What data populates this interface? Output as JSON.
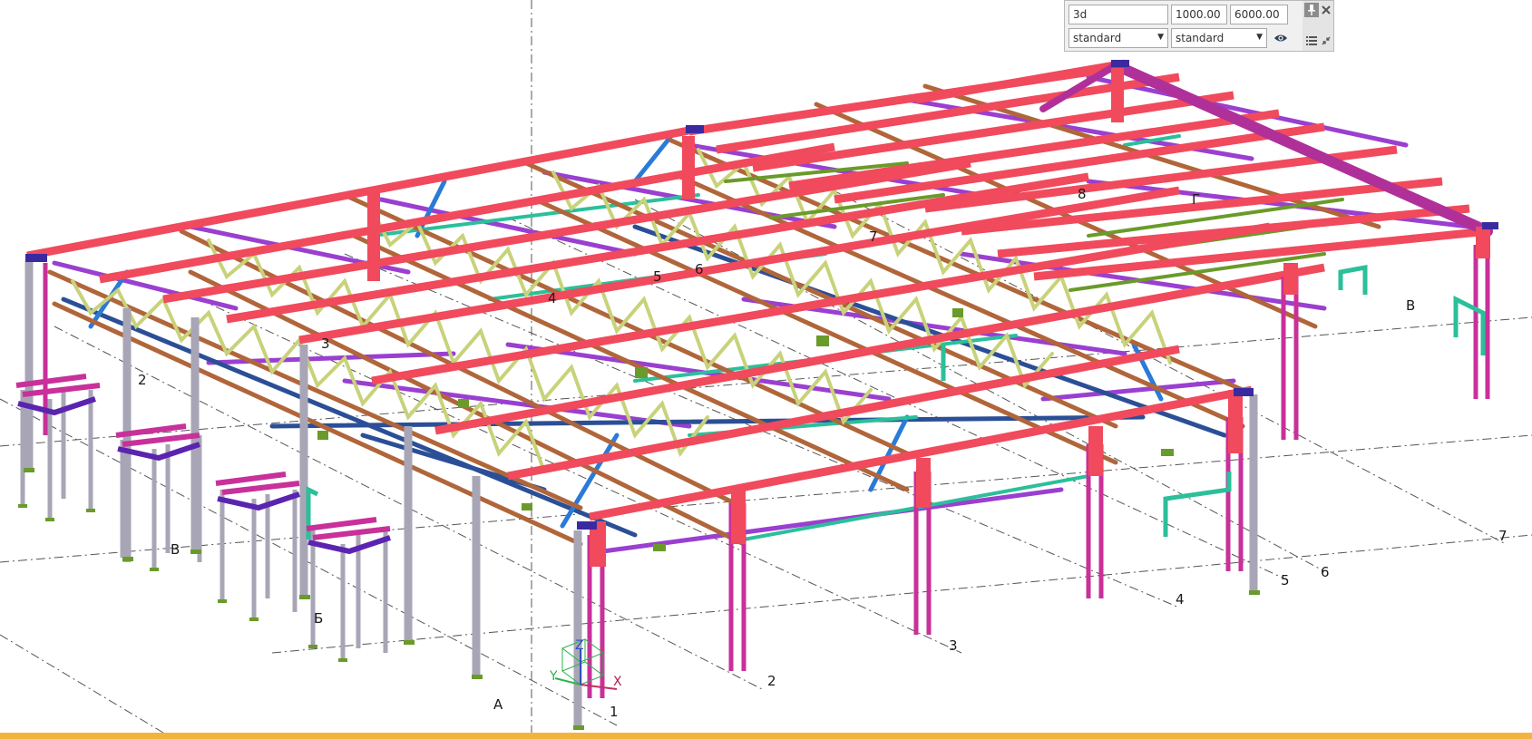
{
  "viewport": {
    "grid_labels_numbers": [
      "1",
      "2",
      "2",
      "3",
      "3",
      "4",
      "4",
      "5",
      "5",
      "6",
      "6",
      "7",
      "7",
      "8"
    ],
    "grid_labels_letters": [
      "А",
      "Б",
      "В",
      "В",
      "Г"
    ],
    "axes": {
      "x": "X",
      "y": "Y",
      "z": "Z"
    },
    "colors": {
      "rafter": "#f04a5c",
      "chord": "#b0663a",
      "web": "#c8d27a",
      "brace_purple": "#9a3fd0",
      "brace_blue": "#2a7ad8",
      "tie_teal": "#2bbf9a",
      "column_grey": "#a8a6b6",
      "column_magenta": "#c8309a",
      "tie_navy": "#2b4f96"
    }
  },
  "view_panel": {
    "view_name": "3d",
    "value_1": "1000.00",
    "value_2": "6000.00",
    "select_1": "standard",
    "select_2": "standard",
    "icons": {
      "pin": "pin-icon",
      "close": "close-icon",
      "eye": "eye-icon",
      "list": "list-icon",
      "shrink": "shrink-icon"
    }
  },
  "status_bar": {
    "color": "#f3b43f"
  }
}
